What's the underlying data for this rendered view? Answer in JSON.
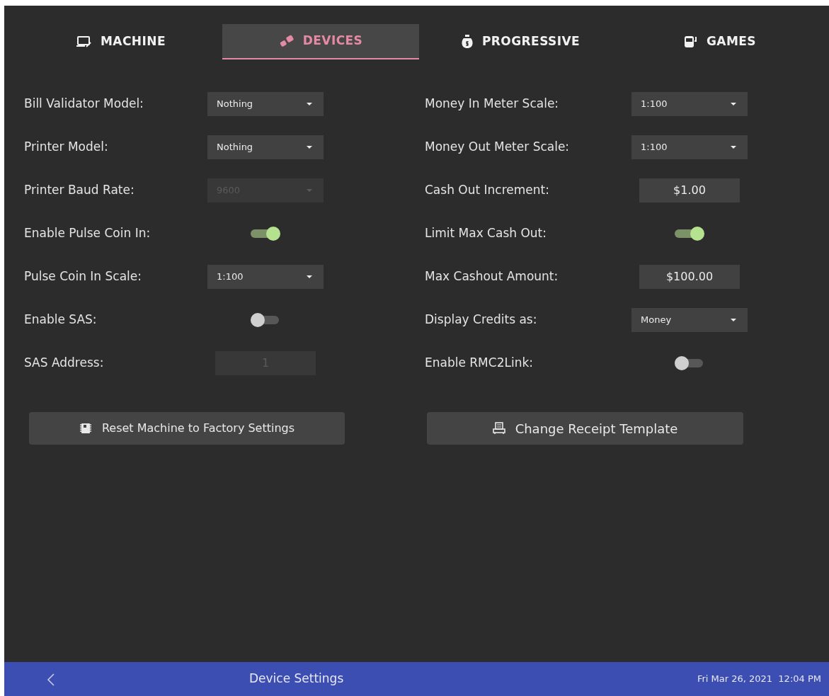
{
  "tabs": [
    {
      "label": "MACHINE",
      "selected": false
    },
    {
      "label": "DEVICES",
      "selected": true
    },
    {
      "label": "PROGRESSIVE",
      "selected": false
    },
    {
      "label": "GAMES",
      "selected": false
    }
  ],
  "left_settings": [
    {
      "label": "Bill Validator Model:",
      "kind": "dropdown",
      "value": "Nothing",
      "disabled": false
    },
    {
      "label": "Printer Model:",
      "kind": "dropdown",
      "value": "Nothing",
      "disabled": false
    },
    {
      "label": "Printer Baud Rate:",
      "kind": "dropdown",
      "value": "9600",
      "disabled": true
    },
    {
      "label": "Enable Pulse Coin In:",
      "kind": "toggle",
      "on": true
    },
    {
      "label": "Pulse Coin In Scale:",
      "kind": "dropdown",
      "value": "1:100",
      "disabled": false
    },
    {
      "label": "Enable SAS:",
      "kind": "toggle",
      "on": false
    },
    {
      "label": "SAS Address:",
      "kind": "text",
      "value": "1",
      "disabled": true
    }
  ],
  "right_settings": [
    {
      "label": "Money In Meter Scale:",
      "kind": "dropdown",
      "value": "1:100",
      "disabled": false
    },
    {
      "label": "Money Out Meter Scale:",
      "kind": "dropdown",
      "value": "1:100",
      "disabled": false
    },
    {
      "label": "Cash Out Increment:",
      "kind": "text",
      "value": "$1.00",
      "disabled": false
    },
    {
      "label": "Limit Max Cash Out:",
      "kind": "toggle",
      "on": true
    },
    {
      "label": "Max Cashout Amount:",
      "kind": "text",
      "value": "$100.00",
      "disabled": false
    },
    {
      "label": "Display Credits as:",
      "kind": "dropdown",
      "value": "Money",
      "disabled": false
    },
    {
      "label": "Enable RMC2Link:",
      "kind": "toggle",
      "on": false
    }
  ],
  "buttons": [
    {
      "label": "Reset Machine to Factory Settings"
    },
    {
      "label": "Change Receipt Template"
    }
  ],
  "status_bar": {
    "title": "Device Settings",
    "datetime": "Fri Mar 26, 2021  12:04 PM"
  }
}
